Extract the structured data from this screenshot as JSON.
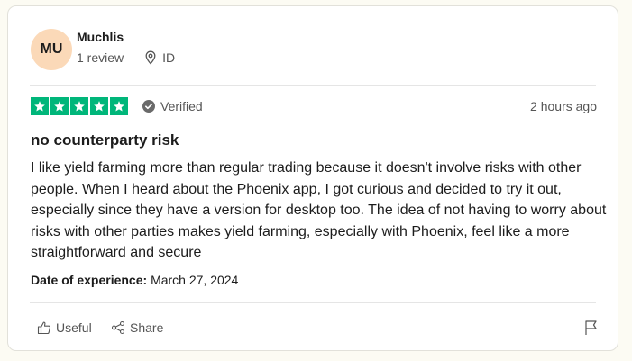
{
  "reviewer": {
    "initials": "MU",
    "name": "Muchlis",
    "review_count": "1 review",
    "location": "ID",
    "avatar_color": "#fbd9b8"
  },
  "rating": {
    "stars": 5,
    "max_stars": 5,
    "star_color": "#00b67a",
    "verified_label": "Verified",
    "time_ago": "2 hours ago"
  },
  "review": {
    "title": "no counterparty risk",
    "body": "I like yield farming more than regular trading because it doesn't involve risks with other people. When I heard about the Phoenix app, I got curious and decided to try it out, especially since they have a version for desktop too. The idea of not having to worry about risks with other parties makes yield farming, especially with Phoenix, feel like a more straightforward and secure",
    "experience_label": "Date of experience:",
    "experience_date": "March 27, 2024"
  },
  "actions": {
    "useful_label": "Useful",
    "share_label": "Share"
  },
  "icons": {
    "location": "location-pin-icon",
    "verified": "check-circle-icon",
    "useful": "thumbs-up-icon",
    "share": "share-icon",
    "report": "flag-icon"
  }
}
